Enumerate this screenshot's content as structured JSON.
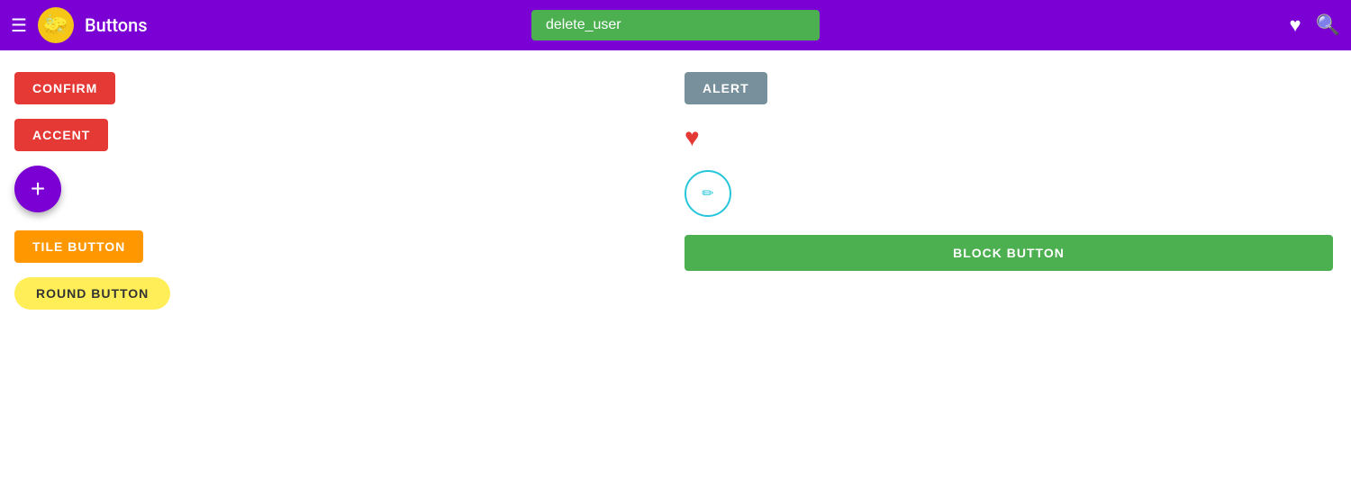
{
  "header": {
    "menu_icon": "☰",
    "logo_emoji": "🧽",
    "title": "Buttons",
    "search_value": "delete_user",
    "search_placeholder": "delete_user",
    "heart_icon": "♥",
    "search_icon": "🔍"
  },
  "buttons": {
    "confirm_label": "CONFIRM",
    "accent_label": "ACCENT",
    "fab_label": "+",
    "tile_label": "TILE BUTTON",
    "round_label": "ROUND BUTTON",
    "alert_label": "ALERT",
    "block_label": "BLOCK BUTTON",
    "edit_icon": "✏"
  },
  "colors": {
    "header_bg": "#7B00D4",
    "confirm_bg": "#e53935",
    "accent_bg": "#e53935",
    "fab_bg": "#7B00D4",
    "tile_bg": "#FF9800",
    "round_bg": "#FFEE58",
    "alert_bg": "#78909C",
    "edit_border": "#26C6DA",
    "block_bg": "#4CAF50",
    "heart_color": "#e53935",
    "search_bg": "#4CAF50"
  }
}
